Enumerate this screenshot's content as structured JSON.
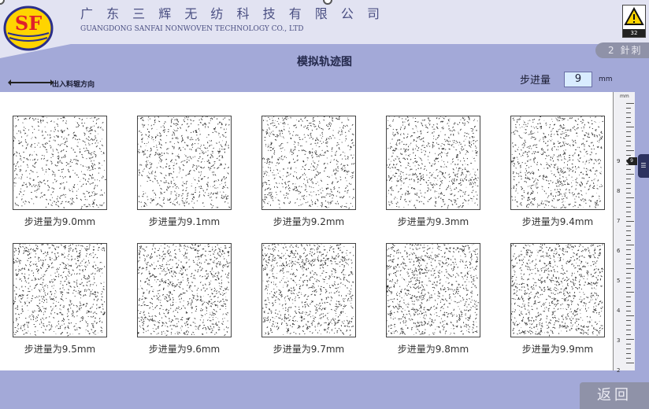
{
  "header": {
    "company_cn": "广 东 三 辉 无 纺 科 技 有 限 公 司",
    "company_en": "GUANGDONG SANFAI NONWOVEN TECHNOLOGY CO., LTD",
    "logo_text": "SF"
  },
  "alarm": {
    "icon": "warning-icon",
    "badge": "32"
  },
  "mode": {
    "label": "2 針刺"
  },
  "page": {
    "title": "模拟轨迹图"
  },
  "direction": {
    "label": "出入料辊方向"
  },
  "step": {
    "label": "步进量",
    "value": "9",
    "unit": "mm"
  },
  "patterns": [
    {
      "label": "步进量为9.0mm"
    },
    {
      "label": "步进量为9.1mm"
    },
    {
      "label": "步进量为9.2mm"
    },
    {
      "label": "步进量为9.3mm"
    },
    {
      "label": "步进量为9.4mm"
    },
    {
      "label": "步进量为9.5mm"
    },
    {
      "label": "步进量为9.6mm"
    },
    {
      "label": "步进量为9.7mm"
    },
    {
      "label": "步进量为9.8mm"
    },
    {
      "label": "步进量为9.9mm"
    }
  ],
  "ruler": {
    "unit": "mm",
    "marks": [
      "9",
      "8",
      "7",
      "6",
      "5",
      "4",
      "3",
      "2"
    ],
    "pointer": "9"
  },
  "footer": {
    "back_label": "返回"
  },
  "colors": {
    "background": "#a3a9d8",
    "header": "#e2e3f2",
    "accent": "#2d3360",
    "logo_red": "#e0202a",
    "logo_yellow": "#ffd400"
  }
}
